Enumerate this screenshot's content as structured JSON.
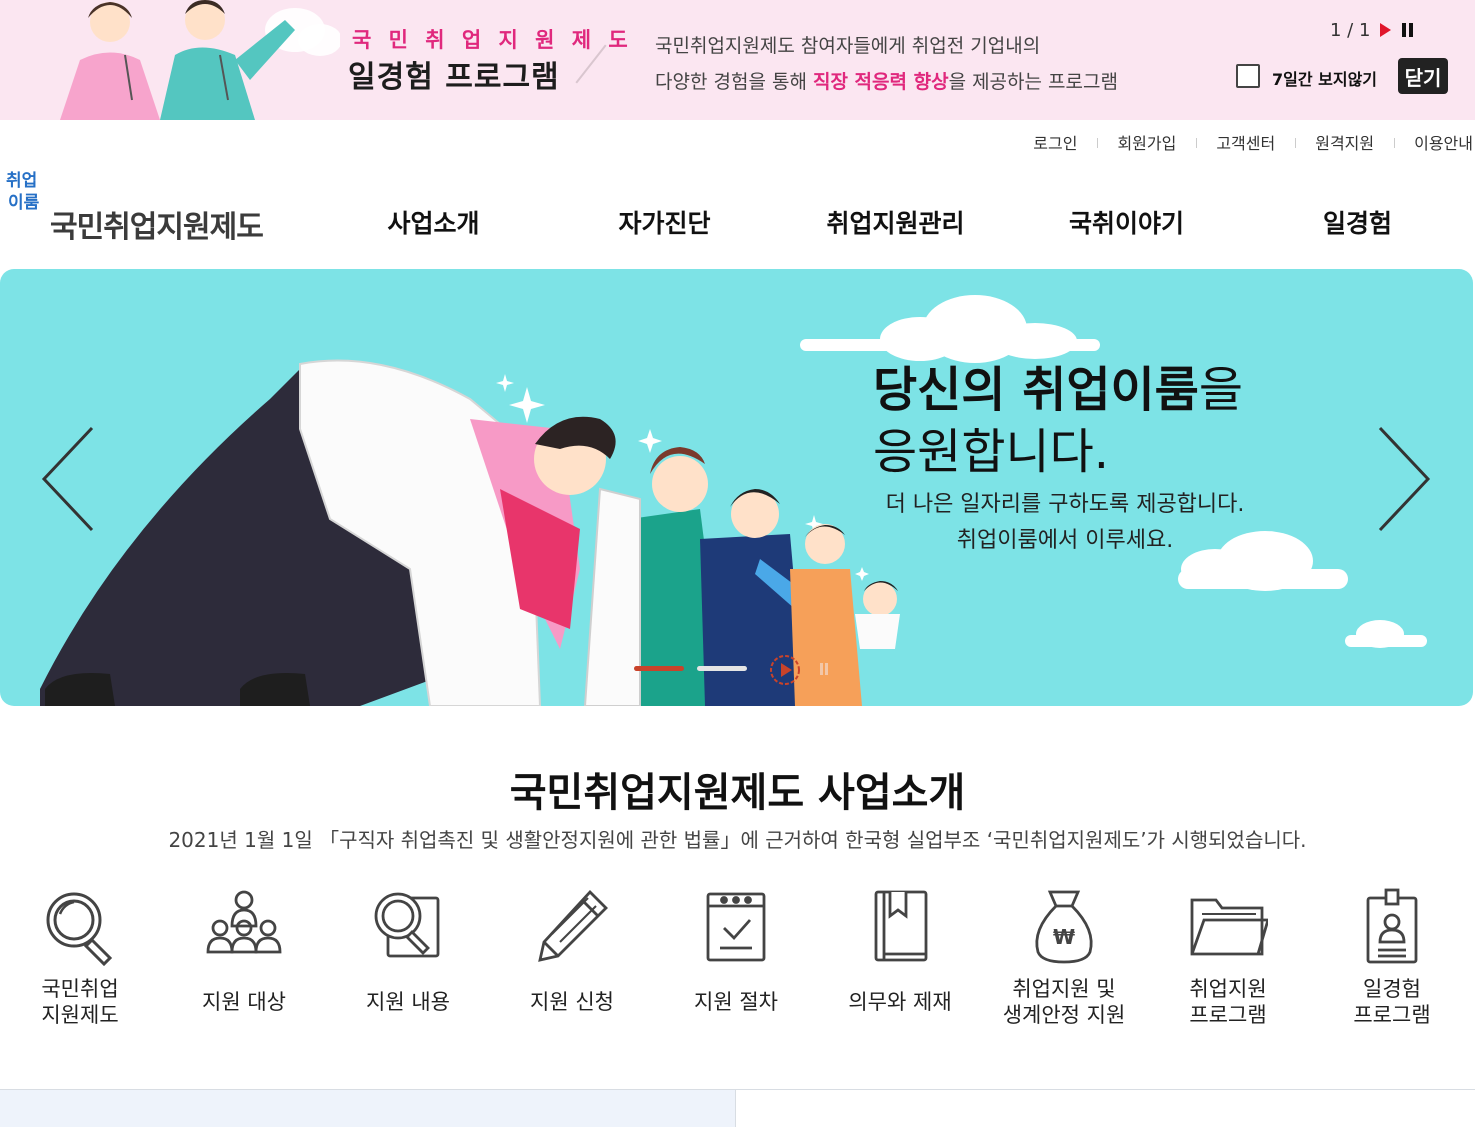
{
  "promo": {
    "kicker": "국 민 취 업 지 원 제 도",
    "headline": "일경험 프로그램",
    "desc_line1": "국민취업지원제도 참여자들에게 취업전 기업내의",
    "desc_line2_a": "다양한 경험을 통해 ",
    "desc_line2_hl": "직장 적응력 향상",
    "desc_line2_b": "을 제공하는 프로그램",
    "counter": "1 / 1",
    "hide_label": "7일간 보지않기",
    "close_label": "닫기"
  },
  "util_nav": [
    "로그인",
    "회원가입",
    "고객센터",
    "원격지원",
    "이용안내"
  ],
  "logo": {
    "mark_line1": "취업",
    "mark_line2": "이룸",
    "name": "국민취업지원제도"
  },
  "gnb": [
    "사업소개",
    "자가진단",
    "취업지원관리",
    "국취이야기",
    "일경험"
  ],
  "hero": {
    "title_bold": "당신의 취업이룸",
    "title_light": "을",
    "title_line2": "응원합니다.",
    "sub_line1": "더 나은 일자리를 구하도록 제공합니다.",
    "sub_line2": "취업이룸에서 이루세요."
  },
  "intro": {
    "title": "국민취업지원제도 사업소개",
    "desc": "2021년 1월 1일 「구직자 취업촉진 및 생활안정지원에 관한 법률」에 근거하여 한국형 실업부조 ‘국민취업지원제도’가 시행되었습니다.",
    "items": [
      {
        "label": "국민취업\n지원제도",
        "icon": "magnifier-icon"
      },
      {
        "label": "지원 대상",
        "icon": "people-group-icon"
      },
      {
        "label": "지원 내용",
        "icon": "document-search-icon"
      },
      {
        "label": "지원 신청",
        "icon": "pencil-icon"
      },
      {
        "label": "지원 절차",
        "icon": "checklist-icon"
      },
      {
        "label": "의무와 제재",
        "icon": "book-icon"
      },
      {
        "label": "취업지원 및\n생계안정 지원",
        "icon": "money-bag-icon"
      },
      {
        "label": "취업지원\n프로그램",
        "icon": "folder-icon"
      },
      {
        "label": "일경험\n프로그램",
        "icon": "id-badge-icon"
      }
    ]
  },
  "colors": {
    "promo_bg": "#fbe6f1",
    "promo_accent": "#e0287d",
    "hero_bg": "#7de3e6",
    "logo_blue": "#2670c6",
    "indicator_active": "#c9432a"
  }
}
